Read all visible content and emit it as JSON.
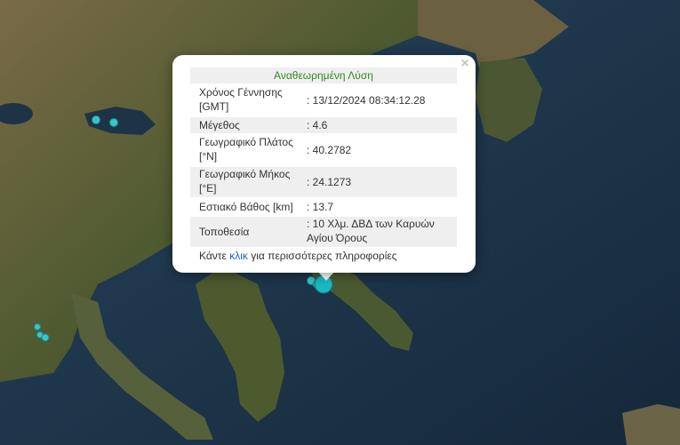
{
  "popup": {
    "title": "Αναθεωρημένη Λύση",
    "close_glyph": "×",
    "rows": [
      {
        "label": "Χρόνος Γέννησης [GMT]",
        "value": ": 13/12/2024 08:34:12.28"
      },
      {
        "label": "Μέγεθος",
        "value": ": 4.6"
      },
      {
        "label": "Γεωγραφικό Πλάτος [°N]",
        "value": ": 40.2782"
      },
      {
        "label": "Γεωγραφικό Μήκος [°E]",
        "value": ": 24.1273"
      },
      {
        "label": "Εστιακό Βάθος [km]",
        "value": ": 13.7"
      },
      {
        "label": "Τοποθεσία",
        "value": ": 10 Χλμ. ΔΒΔ των Καρυών Αγίου Όρους"
      }
    ],
    "footer_pre": "Κάντε ",
    "footer_link": "κλικ",
    "footer_post": " για περισσότερες πληροφορίες"
  },
  "map": {
    "marker_color": "#3cc3c8",
    "selected_marker_color": "#1cb8c4",
    "sea_color": "#1b3347",
    "land_color": "#5a5a35"
  }
}
